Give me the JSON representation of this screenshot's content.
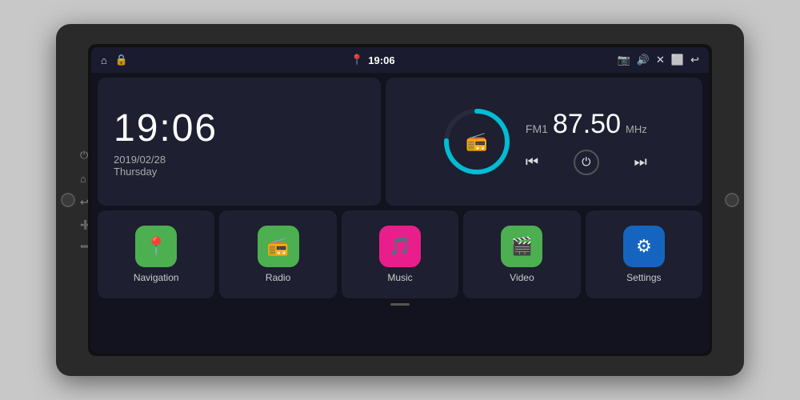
{
  "device": {
    "background_color": "#2a2a2a"
  },
  "status_bar": {
    "left_icons": [
      "⌂",
      "🔒"
    ],
    "pin_icon": "📍",
    "time": "19:06",
    "camera_icon": "📷",
    "volume_icon": "🔊",
    "close_icon": "✕",
    "window_icon": "⬜",
    "back_icon": "↩"
  },
  "clock": {
    "time": "19:06",
    "date": "2019/02/28",
    "day": "Thursday"
  },
  "radio": {
    "band": "FM1",
    "frequency": "87.50",
    "unit": "MHz",
    "prev_icon": "⏮",
    "power_icon": "⏻",
    "next_icon": "⏭"
  },
  "apps": [
    {
      "id": "navigation",
      "label": "Navigation",
      "icon": "📍",
      "color_class": "nav-color"
    },
    {
      "id": "radio",
      "label": "Radio",
      "icon": "📻",
      "color_class": "radio-color"
    },
    {
      "id": "music",
      "label": "Music",
      "icon": "🎵",
      "color_class": "music-color"
    },
    {
      "id": "video",
      "label": "Video",
      "icon": "🎬",
      "color_class": "video-color"
    },
    {
      "id": "settings",
      "label": "Settings",
      "icon": "⚙",
      "color_class": "settings-color"
    }
  ],
  "side_buttons": {
    "power_icon": "⏻",
    "home_icon": "⌂",
    "back_icon": "↩",
    "vol_up_icon": "🔊",
    "vol_down_icon": "🔉"
  }
}
